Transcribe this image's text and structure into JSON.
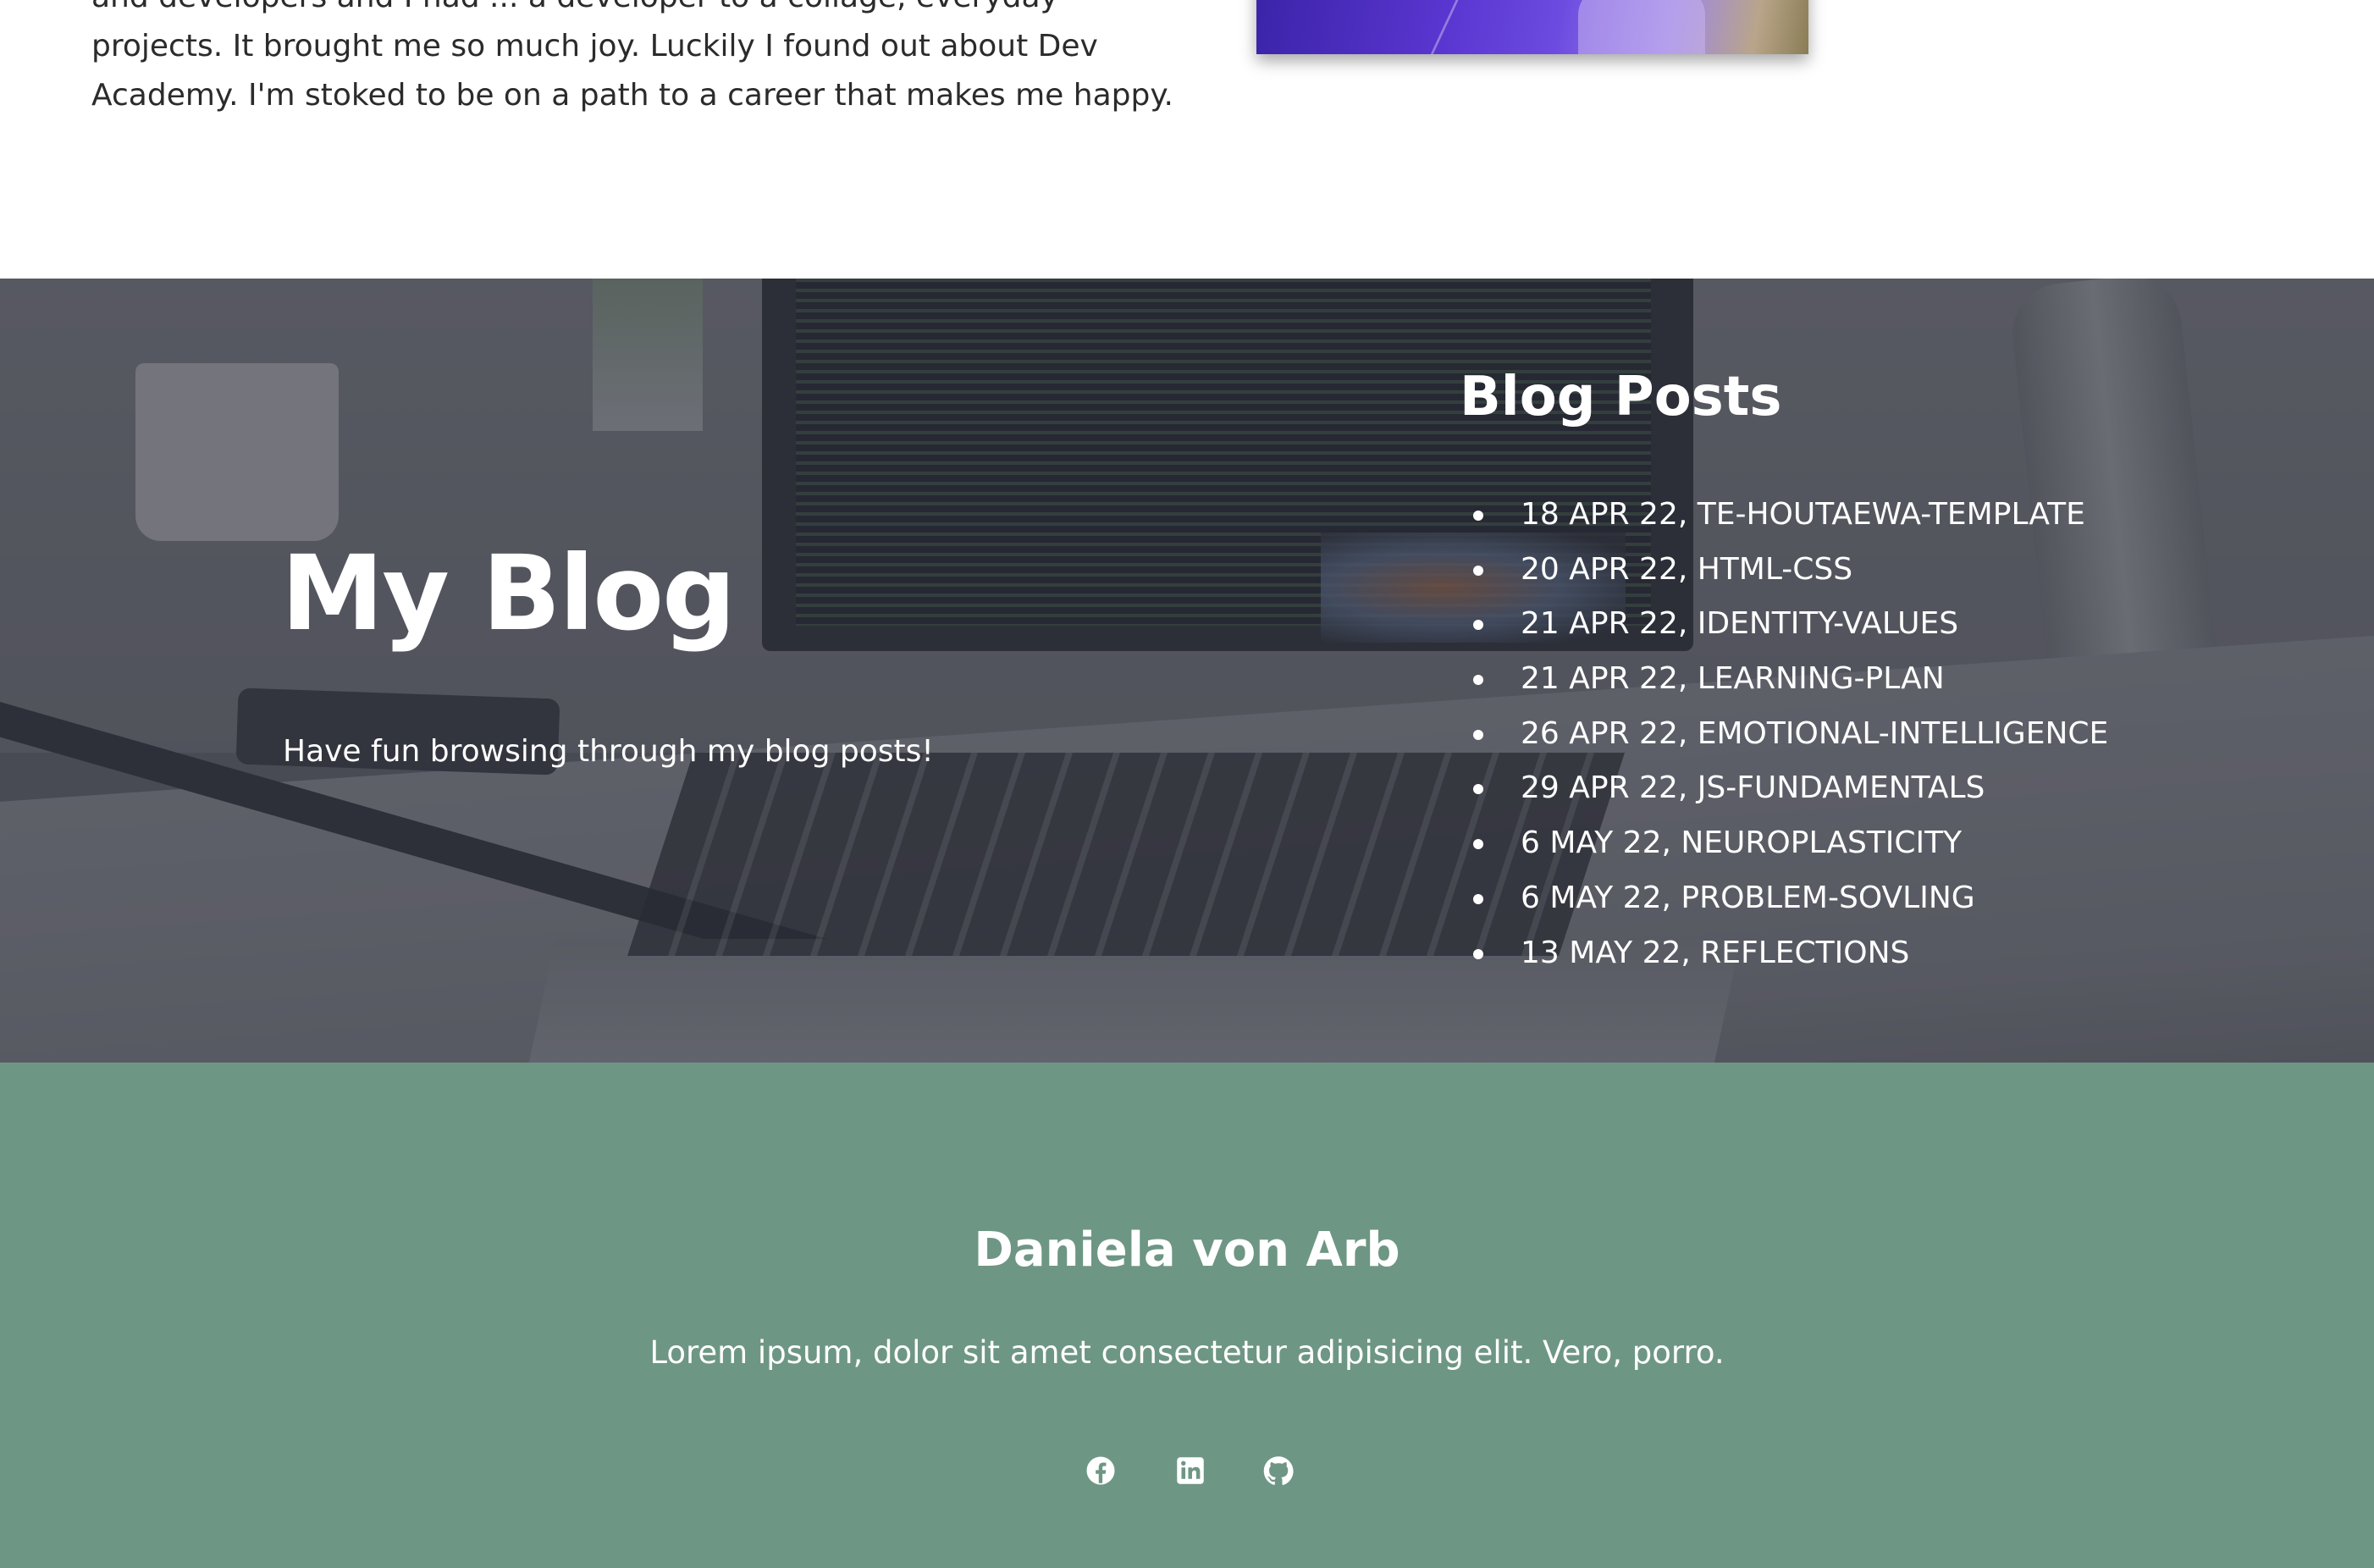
{
  "about": {
    "paragraph_lines": [
      "and developers and I had ... a developer to a collage, everyday",
      "projects. It brought me so much joy. Luckily I found out about Dev",
      "Academy. I'm stoked to be on a path to a career that makes me happy."
    ]
  },
  "blog": {
    "title": "My Blog",
    "subtitle": "Have fun browsing through my blog posts!",
    "posts_heading": "Blog Posts",
    "posts": [
      "18 APR 22, TE-HOUTAEWA-TEMPLATE",
      "20 APR 22, HTML-CSS",
      "21 APR 22, IDENTITY-VALUES",
      "21 APR 22, LEARNING-PLAN",
      "26 APR 22, EMOTIONAL-INTELLIGENCE",
      "29 APR 22, JS-FUNDAMENTALS",
      "6 MAY 22, NEUROPLASTICITY",
      "6 MAY 22, PROBLEM-SOVLING",
      "13 MAY 22, REFLECTIONS"
    ]
  },
  "footer": {
    "name": "Daniela von Arb",
    "text": "Lorem ipsum, dolor sit amet consectetur adipisicing elit. Vero, porro.",
    "social_icons": [
      "facebook-icon",
      "linkedin-icon",
      "github-icon"
    ]
  },
  "colors": {
    "footer_bg": "#6e9684",
    "text_dark": "#2b2b2b",
    "text_light": "#ffffff"
  }
}
